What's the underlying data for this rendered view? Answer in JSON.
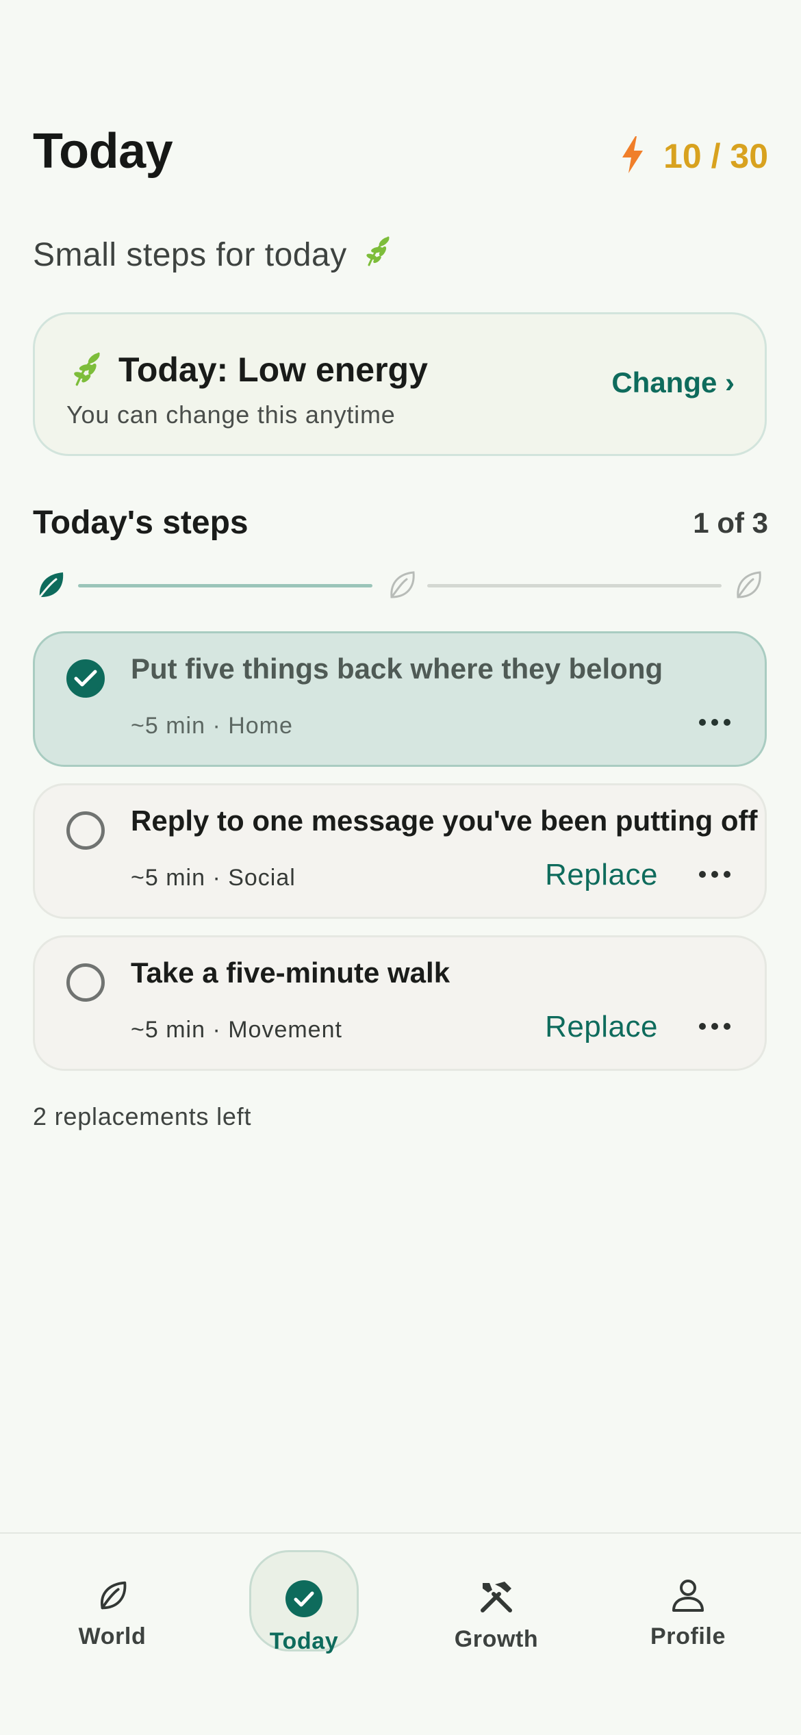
{
  "header": {
    "title": "Today",
    "energy_value": "10 / 30",
    "subtitle": "Small steps for today"
  },
  "energy_card": {
    "title": "Today: Low energy",
    "subtitle": "You can change this anytime",
    "change_label": "Change ›"
  },
  "steps": {
    "heading": "Today's steps",
    "count": "1 of 3",
    "progress_completed": 1,
    "progress_total": 3
  },
  "tasks": [
    {
      "title": "Put five things back where they belong",
      "meta": "~5 min · Home",
      "done": true
    },
    {
      "title": "Reply to one message you've been putting off",
      "meta": "~5 min · Social",
      "replace_label": "Replace",
      "done": false
    },
    {
      "title": "Take a five-minute walk",
      "meta": "~5 min · Movement",
      "replace_label": "Replace",
      "done": false
    }
  ],
  "replacements_left": "2 replacements left",
  "tabbar": {
    "items": [
      {
        "label": "World",
        "icon": "leaf-icon"
      },
      {
        "label": "Today",
        "icon": "check-circle-icon",
        "active": true
      },
      {
        "label": "Growth",
        "icon": "tools-icon"
      },
      {
        "label": "Profile",
        "icon": "person-icon"
      }
    ]
  },
  "colors": {
    "accent": "#0e6b5c",
    "energy": "#d8a21f",
    "bolt": "#f07f2a",
    "sprout": "#7dbd3a",
    "background": "#f6f9f4"
  }
}
